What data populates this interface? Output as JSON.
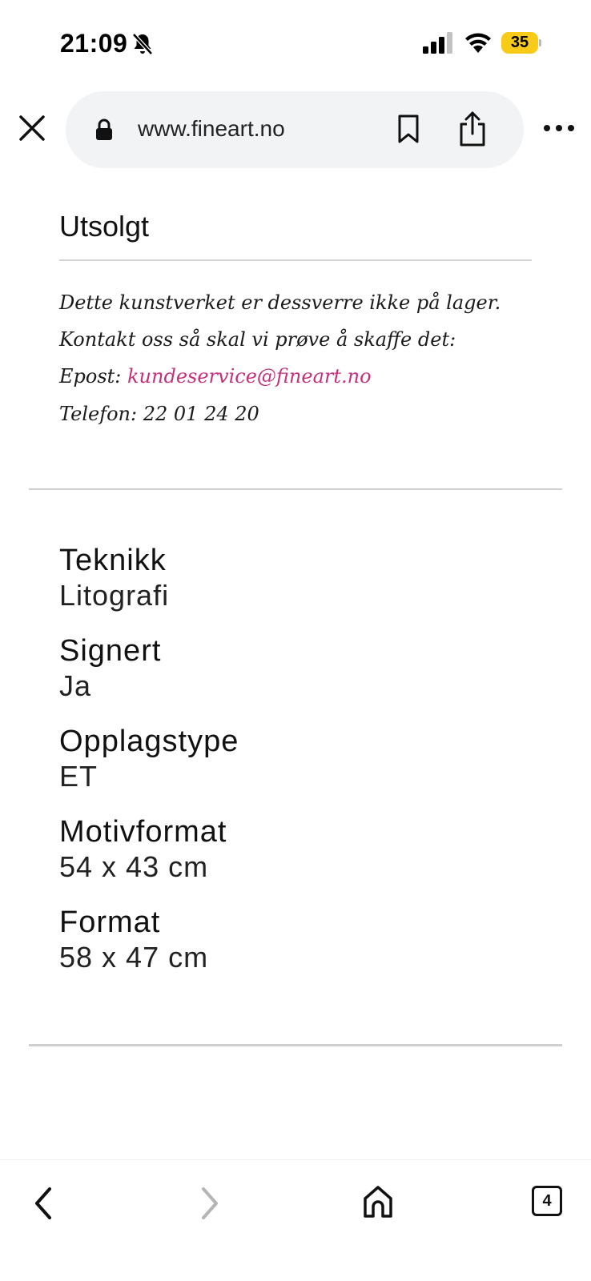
{
  "status_bar": {
    "time": "21:09",
    "battery_level": "35",
    "icons": [
      "bell-slash-icon",
      "cellular-signal-icon",
      "wifi-icon",
      "battery-icon"
    ]
  },
  "browser": {
    "url": "www.fineart.no",
    "icons": [
      "close-icon",
      "lock-icon",
      "bookmark-icon",
      "share-icon",
      "more-icon"
    ]
  },
  "soldout": {
    "title": "Utsolgt",
    "line1": "Dette kunstverket er dessverre ikke på lager.",
    "line2": "Kontakt oss så skal vi prøve å skaffe det:",
    "email_label": "Epost: ",
    "email": "kundeservice@fineart.no",
    "phone": "Telefon: 22 01 24 20"
  },
  "specs": [
    {
      "label": "Teknikk",
      "value": "Litografi"
    },
    {
      "label": "Signert",
      "value": "Ja"
    },
    {
      "label": "Opplagstype",
      "value": "ET"
    },
    {
      "label": "Motivformat",
      "value": "54 x 43 cm"
    },
    {
      "label": "Format",
      "value": "58 x 47 cm"
    }
  ],
  "toolbar": {
    "tab_count": "4",
    "icons": [
      "back-icon",
      "forward-icon",
      "home-icon",
      "tabs-icon"
    ]
  },
  "colors": {
    "link": "#c5307c",
    "battery": "#f7cb18",
    "url_bar_bg": "#f2f3f5"
  }
}
